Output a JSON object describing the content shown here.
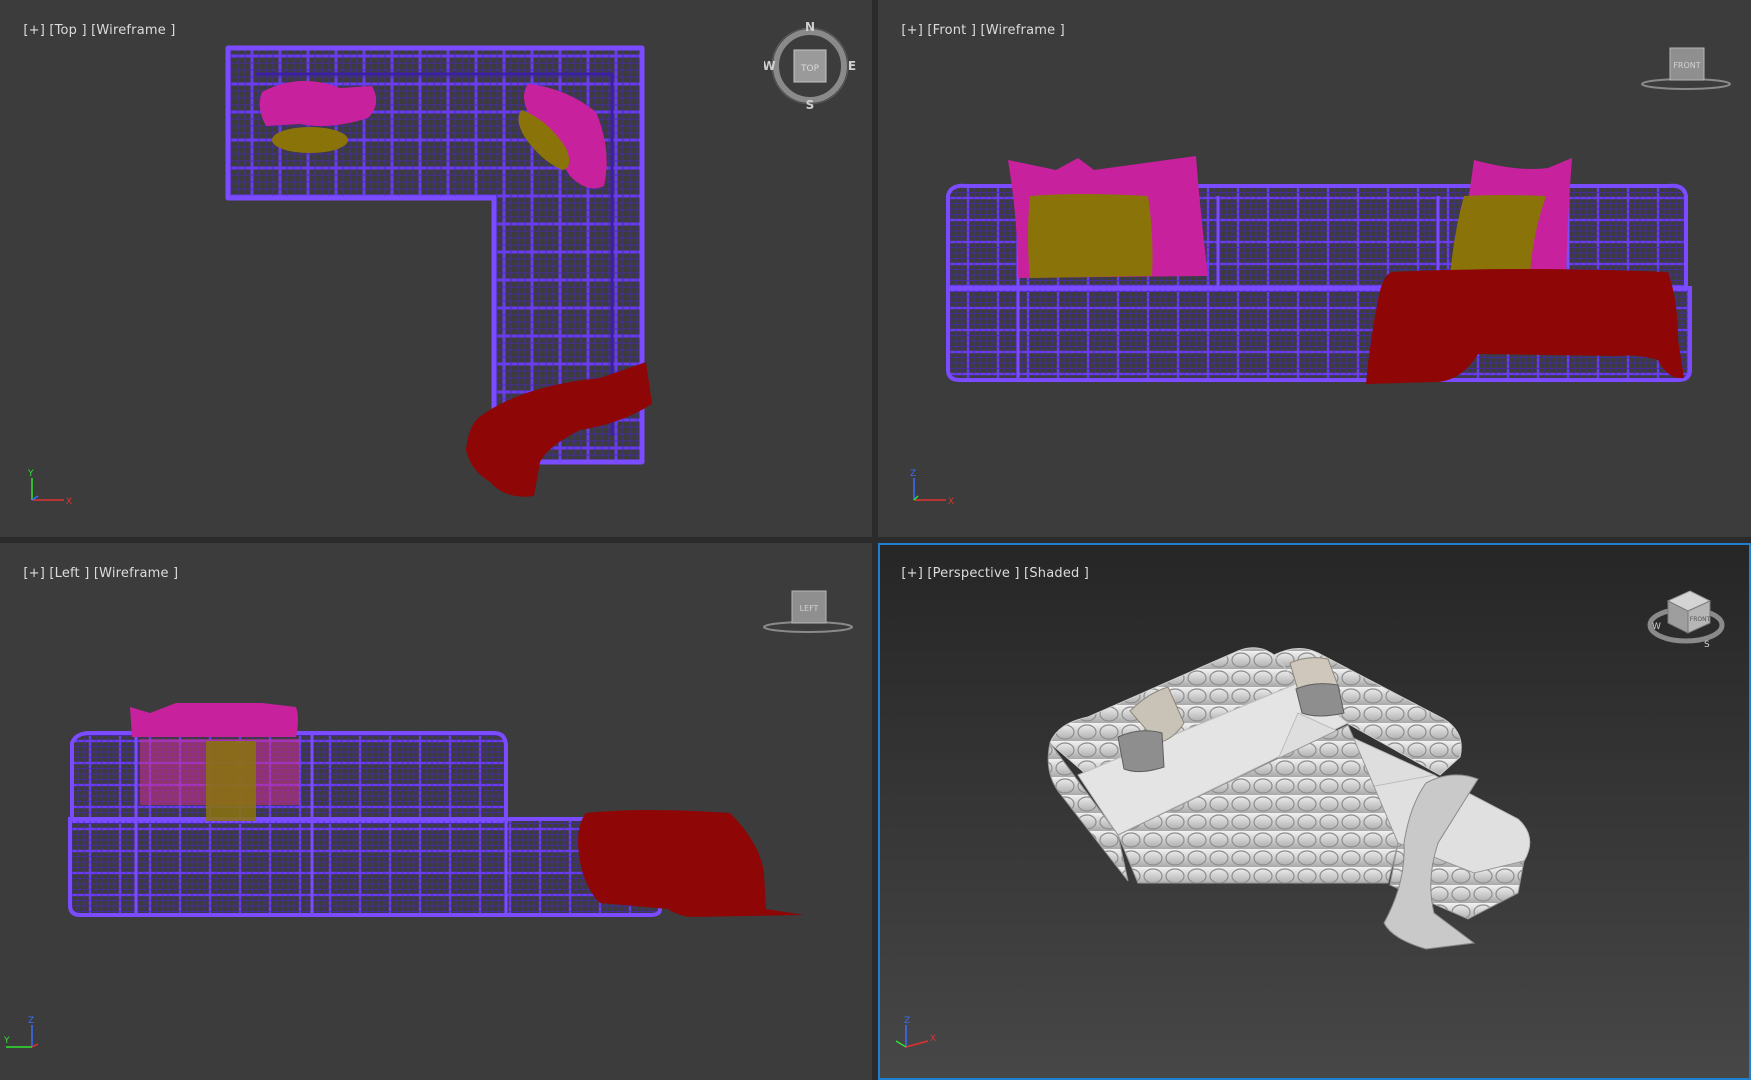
{
  "viewports": {
    "top": {
      "parts": [
        "[+]",
        "[Top ]",
        "[Wireframe ]"
      ]
    },
    "front": {
      "parts": [
        "[+]",
        "[Front ]",
        "[Wireframe ]"
      ]
    },
    "left": {
      "parts": [
        "[+]",
        "[Left ]",
        "[Wireframe ]"
      ]
    },
    "persp": {
      "parts": [
        "[+]",
        "[Perspective ]",
        "[Shaded ]"
      ]
    }
  },
  "gizmos": {
    "top": {
      "face": "TOP",
      "n": "N",
      "s": "S",
      "e": "E",
      "w": "W"
    },
    "front": {
      "face": "FRONT"
    },
    "left": {
      "face": "LEFT"
    },
    "persp": {
      "face": "FRONT",
      "w": "W",
      "s": "S"
    }
  },
  "axes": {
    "top": {
      "v": "Y",
      "h": "X"
    },
    "front": {
      "v": "Z",
      "h": "X"
    },
    "left": {
      "v": "Z",
      "h": "Y"
    },
    "persp": {
      "v": "Z",
      "h": "X"
    }
  },
  "colors": {
    "wire": "#5a2fd6",
    "wire_dark": "#3b1fa8",
    "pillow_magenta": "#c8219e",
    "pillow_olive": "#8a740a",
    "throw_red": "#8e0606",
    "active_border": "#1f7fd0"
  }
}
